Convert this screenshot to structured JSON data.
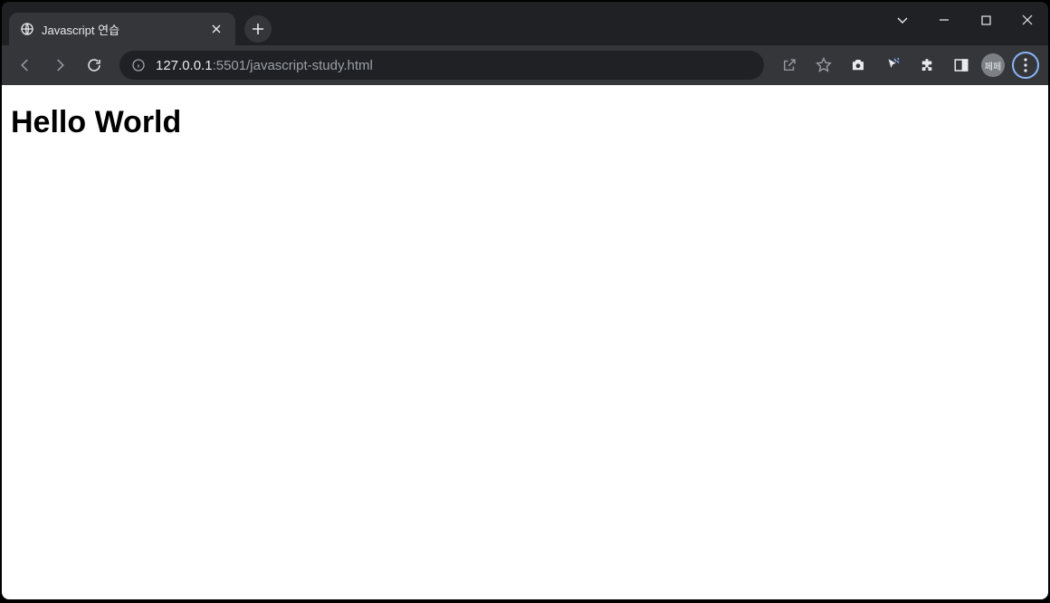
{
  "tab": {
    "title": "Javascript 연습"
  },
  "url": {
    "host": "127.0.0.1",
    "port": ":5501",
    "path": "/javascript-study.html"
  },
  "avatar": {
    "initials": "페페"
  },
  "page": {
    "heading": "Hello World"
  }
}
